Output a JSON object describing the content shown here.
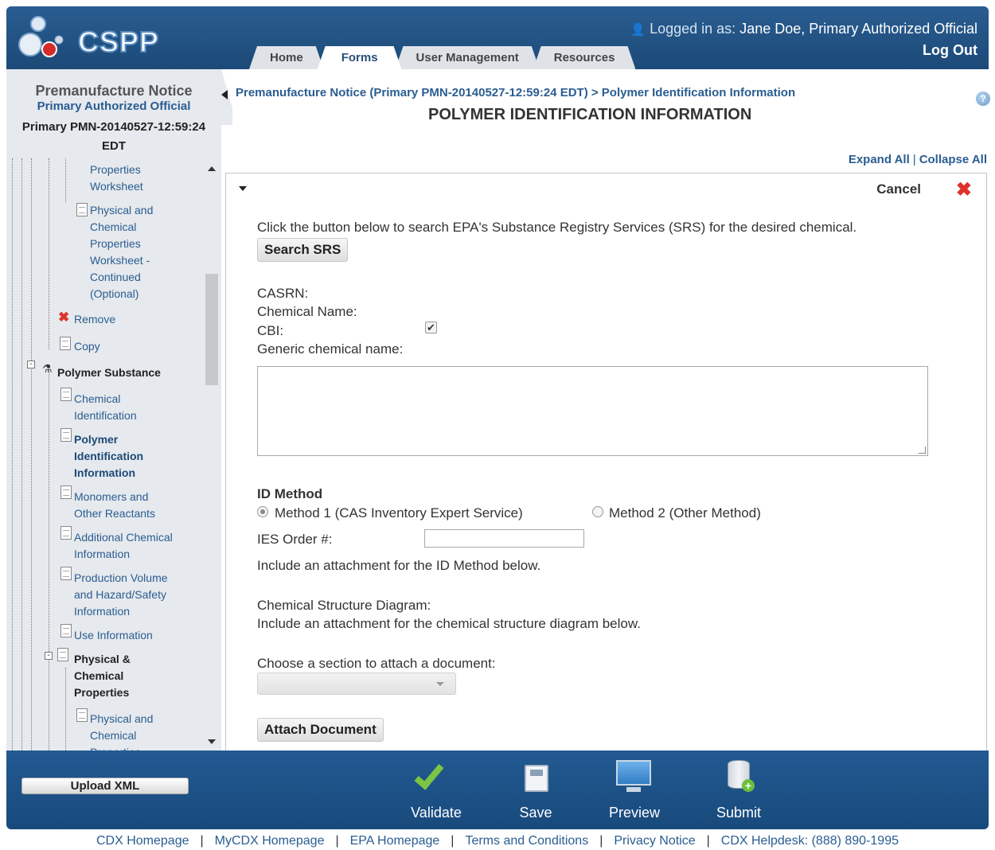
{
  "header": {
    "logo_text": "CSPP",
    "login_label": "Logged in as:",
    "login_user": "Jane Doe, Primary Authorized Official",
    "logout": "Log Out",
    "tabs": [
      {
        "label": "Home"
      },
      {
        "label": "Forms"
      },
      {
        "label": "User Management"
      },
      {
        "label": "Resources"
      }
    ],
    "active_tab": "Forms"
  },
  "sidebar": {
    "title": "Premanufacture Notice",
    "subtitle": "Primary Authorized Official",
    "pmn_line1": "Primary PMN-20140527-12:59:24",
    "pmn_line2": "EDT",
    "tree": {
      "properties_worksheet": [
        "Properties",
        "Worksheet"
      ],
      "physchem_continued": [
        "Physical and",
        "Chemical",
        "Properties",
        "Worksheet -",
        "Continued",
        "(Optional)"
      ],
      "remove": "Remove",
      "copy": "Copy",
      "polymer_substance": "Polymer Substance",
      "chemical_identification": [
        "Chemical",
        "Identification"
      ],
      "polymer_identification": [
        "Polymer",
        "Identification",
        "Information"
      ],
      "monomers": [
        "Monomers and",
        "Other Reactants"
      ],
      "additional_chemical": [
        "Additional Chemical",
        "Information"
      ],
      "production_volume": [
        "Production Volume",
        "and Hazard/Safety",
        "Information"
      ],
      "use_information": "Use Information",
      "physical_chemical_props": [
        "Physical &",
        "Chemical",
        "Properties"
      ],
      "physchem_worksheet": [
        "Physical and",
        "Chemical",
        "Properties"
      ]
    }
  },
  "main": {
    "breadcrumb": "Premanufacture Notice (Primary PMN-20140527-12:59:24 EDT) > Polymer Identification Information",
    "title": "POLYMER IDENTIFICATION INFORMATION",
    "help": "?",
    "expand_all": "Expand All",
    "collapse_all": "Collapse All",
    "separator": "|",
    "cancel": "Cancel",
    "srs_instruction": "Click the button below to search EPA's Substance Registry Services (SRS) for the desired chemical.",
    "search_srs": "Search SRS",
    "casrn_label": "CASRN:",
    "chemical_name_label": "Chemical Name:",
    "cbi_label": "CBI:",
    "cbi_checked": true,
    "generic_name_label": "Generic chemical name:",
    "generic_name_value": "",
    "id_method_heading": "ID Method",
    "method1_label": "Method 1 (CAS Inventory Expert Service)",
    "method2_label": "Method 2 (Other Method)",
    "selected_method": "Method 1 (CAS Inventory Expert Service)",
    "ies_order_label": "IES Order #:",
    "ies_order_value": "",
    "attach_id_note": "Include an attachment for the ID Method below.",
    "structure_label": "Chemical Structure Diagram:",
    "structure_note": "Include an attachment for the chemical structure diagram below.",
    "choose_section_label": "Choose a section to attach a document:",
    "choose_section_value": "",
    "attach_document": "Attach Document"
  },
  "toolbar": {
    "upload_xml": "Upload XML",
    "validate": "Validate",
    "save": "Save",
    "preview": "Preview",
    "submit": "Submit"
  },
  "footer": {
    "links": [
      "CDX Homepage",
      "MyCDX Homepage",
      "EPA Homepage",
      "Terms and Conditions",
      "Privacy Notice",
      "CDX Helpdesk: (888) 890-1995"
    ],
    "separator": "|"
  },
  "colors": {
    "brand_blue": "#1c4a78",
    "link_blue": "#2a5d91",
    "cancel_red": "#e0312b",
    "validate_green": "#7cc443"
  }
}
